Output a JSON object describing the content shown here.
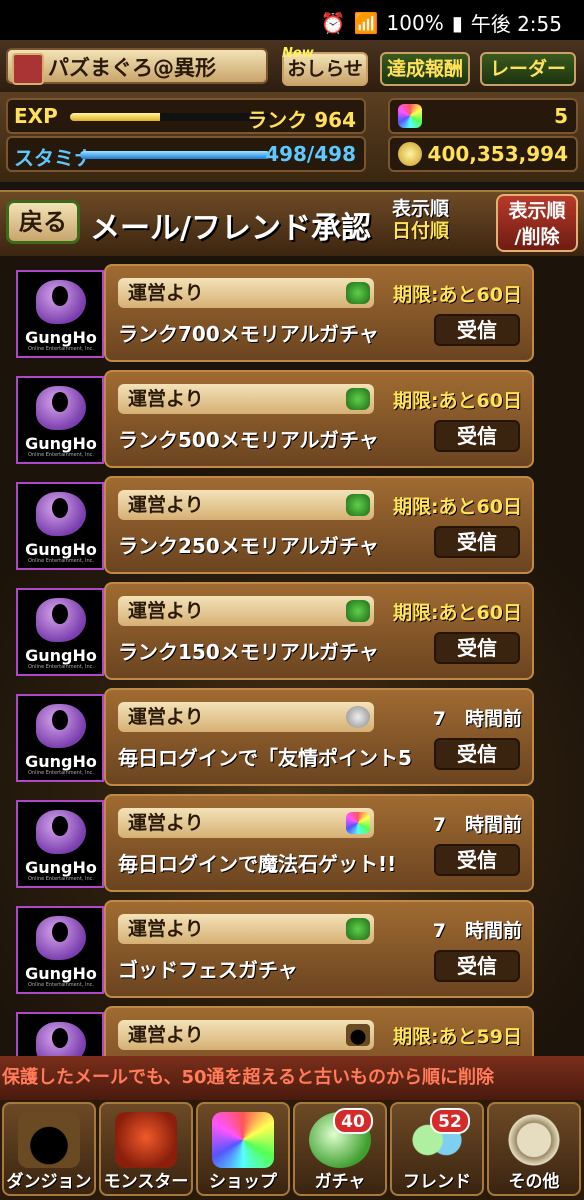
{
  "status_bar": {
    "battery": "100%",
    "time": "午後 2:55"
  },
  "player": {
    "name": "パズまぐろ@異形"
  },
  "top_buttons": {
    "notice_label": "おしらせ",
    "notice_badge": "New",
    "achievement_label": "達成報酬",
    "radar_label": "レーダー"
  },
  "stats": {
    "exp_label": "EXP",
    "rank_label": "ランク 964",
    "stamina_label": "スタミナ",
    "stamina_value": "498/498",
    "stamina_fill": 1.0,
    "exp_fill": 0.45,
    "magic_stones": "5",
    "coins": "400,353,994"
  },
  "header": {
    "back_label": "戻る",
    "title": "メール/フレンド承認",
    "sort_label": "表示順",
    "sort_value": "日付順",
    "sort_delete_line1": "表示順",
    "sort_delete_line2": "/削除"
  },
  "mails": [
    {
      "from": "運営より",
      "limit": "期限:あと60日",
      "subject": "ランク700メモリアルガチャ",
      "button": "受信",
      "icon": "dragon-icon"
    },
    {
      "from": "運営より",
      "limit": "期限:あと60日",
      "subject": "ランク500メモリアルガチャ",
      "button": "受信",
      "icon": "dragon-icon"
    },
    {
      "from": "運営より",
      "limit": "期限:あと60日",
      "subject": "ランク250メモリアルガチャ",
      "button": "受信",
      "icon": "dragon-icon"
    },
    {
      "from": "運営より",
      "limit": "期限:あと60日",
      "subject": "ランク150メモリアルガチャ",
      "button": "受信",
      "icon": "dragon-icon"
    },
    {
      "from": "運営より",
      "limit": "7　時間前",
      "subject": "毎日ログインで「友情ポイント5",
      "button": "受信",
      "icon": "friend-point-icon"
    },
    {
      "from": "運営より",
      "limit": "7　時間前",
      "subject": "毎日ログインで魔法石ゲット!!",
      "button": "受信",
      "icon": "magic-stone-icon"
    },
    {
      "from": "運営より",
      "limit": "7　時間前",
      "subject": "ゴッドフェスガチャ",
      "button": "受信",
      "icon": "dragon-icon"
    },
    {
      "from": "運営より",
      "limit": "期限:あと59日",
      "subject": "",
      "button": "",
      "icon": "dungeon-icon"
    }
  ],
  "avatar": {
    "brand": "GungHo",
    "sub": "Online Entertainment, Inc."
  },
  "notice": "保護したメールでも、50通を超えると古いものから順に削除",
  "nav": [
    {
      "label": "ダンジョン"
    },
    {
      "label": "モンスター"
    },
    {
      "label": "ショップ"
    },
    {
      "label": "ガチャ",
      "badge": "40"
    },
    {
      "label": "フレンド",
      "badge": "52"
    },
    {
      "label": "その他"
    }
  ]
}
